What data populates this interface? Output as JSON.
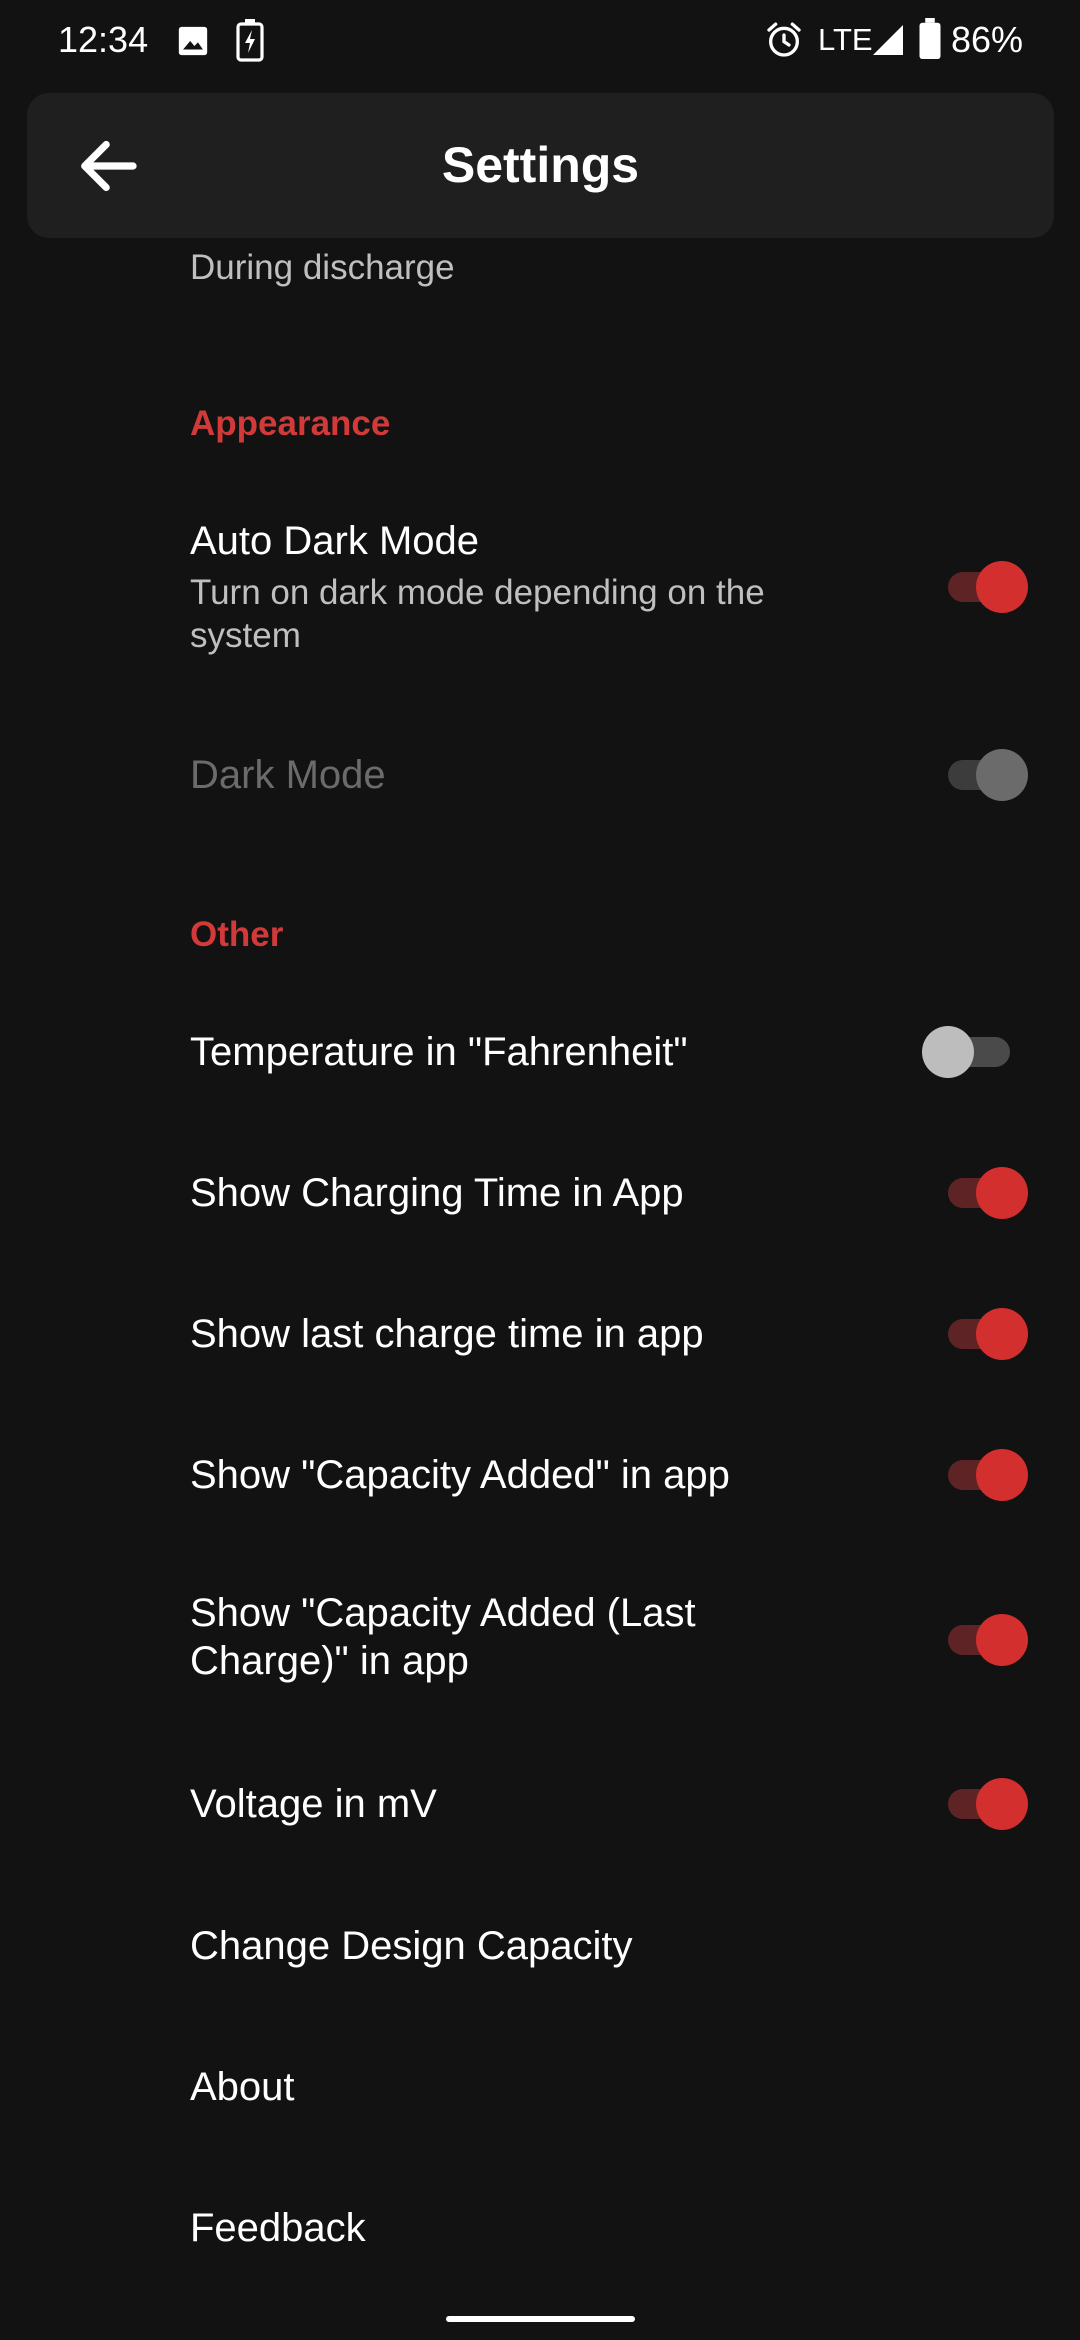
{
  "status_bar": {
    "time": "12:34",
    "network": "LTE",
    "battery": "86%",
    "icons": [
      "image-icon",
      "battery-charging-icon",
      "alarm-icon",
      "signal-icon",
      "battery-icon"
    ]
  },
  "app_bar": {
    "title": "Settings",
    "back_icon": "arrow-back-icon"
  },
  "top_summary": "During discharge",
  "sections": {
    "appearance": {
      "header": "Appearance",
      "auto_dark_mode": {
        "title": "Auto Dark Mode",
        "summary": "Turn on dark mode depending on the system",
        "checked": true
      },
      "dark_mode": {
        "title": "Dark Mode",
        "checked": true,
        "enabled": false
      }
    },
    "other": {
      "header": "Other",
      "items": [
        {
          "title": "Temperature in \"Fahrenheit\"",
          "checked": false
        },
        {
          "title": "Show Charging Time in App",
          "checked": true
        },
        {
          "title": "Show last charge time in app",
          "checked": true
        },
        {
          "title": "Show \"Capacity Added\" in app",
          "checked": true
        },
        {
          "title": "Show \"Capacity Added (Last Charge)\" in app",
          "checked": true
        },
        {
          "title": "Voltage in mV",
          "checked": true
        },
        {
          "title": "Change Design Capacity"
        },
        {
          "title": "About"
        },
        {
          "title": "Feedback"
        }
      ]
    }
  },
  "colors": {
    "background": "#121212",
    "app_bar": "#1f1f1f",
    "accent": "#d32f2f",
    "accent_track": "#5e2425",
    "disabled_text": "#6b6b6b"
  }
}
